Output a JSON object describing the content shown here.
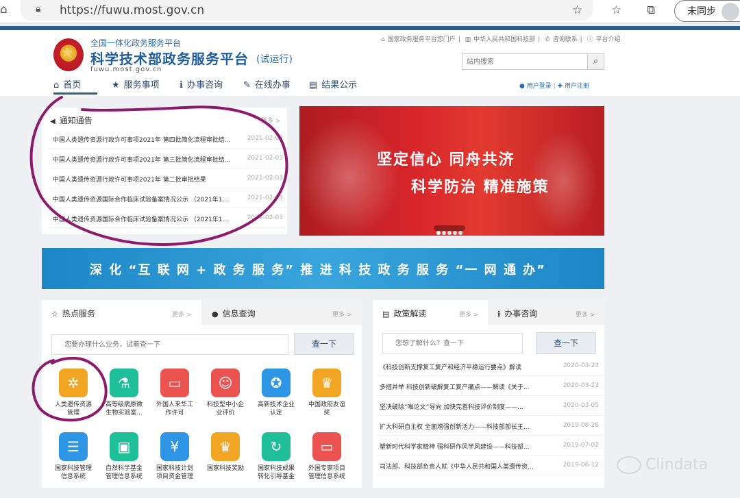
{
  "browser": {
    "url": "https://fuwu.most.gov.cn",
    "sync_label": "未同步"
  },
  "header": {
    "portal_sub": "全国一体化政务服务平台",
    "portal_title": "科学技术部政务服务平台",
    "portal_trial": "(试运行)",
    "portal_domain": "fuwu.most.gov.cn",
    "top_links": [
      "国家政务服务平台您门户",
      "中华人民共和国科技部",
      "咨询联系",
      "平台介绍"
    ],
    "search_placeholder": "站内搜索",
    "login": "用户登录",
    "register": "用户注册"
  },
  "nav": {
    "items": [
      "首页",
      "服务事项",
      "办事咨询",
      "在线办事",
      "结果公示"
    ]
  },
  "notice": {
    "title": "通知通告",
    "more": "更多 >",
    "rows": [
      {
        "title": "中国人类遗传资源行政许可事项2021年 第四批简化流程审批结...",
        "date": "2021-02-03"
      },
      {
        "title": "中国人类遗传资源行政许可事项2021年 第三批简化流程审批结...",
        "date": "2021-02-03"
      },
      {
        "title": "中国人类遗传资源行政许可事项2021年 第二批审批结果",
        "date": "2021-02-03"
      },
      {
        "title": "中国人类遗传资源国际合作临床试验备案情况公示 （2021年1...",
        "date": "2021-02-03"
      },
      {
        "title": "中国人类遗传资源国际合作临床试验备案情况公示 （2021年1...",
        "date": "2021-02-03"
      }
    ]
  },
  "banner": {
    "line1": "坚定信心  同舟共济",
    "line2": "科学防治  精准施策"
  },
  "slogan": {
    "text": "深 化  “互 联 网 + 政 务 服 务”   推 进 科 技 政 务 服 务 “一 网 通 办”"
  },
  "hot": {
    "tab1": "热点服务",
    "tab1_more": "更多 >",
    "tab2": "信息查询",
    "tab2_more": "更多 >",
    "search_placeholder": "您要办理什么业务，试着查一下",
    "search_button": "查一下",
    "services": [
      {
        "label": "人类遗传资源\n管理",
        "color": "#f2a522",
        "icon": "dna-icon"
      },
      {
        "label": "高等级病原微\n生物实验室...",
        "color": "#1fbf9a",
        "icon": "flask-icon"
      },
      {
        "label": "外国人来华工\n作许可",
        "color": "#ea5350",
        "icon": "monitor-icon"
      },
      {
        "label": "科技型中小企\n业评价",
        "color": "#ea5350",
        "icon": "person-icon"
      },
      {
        "label": "高新技术企业\n认定",
        "color": "#2f95e5",
        "icon": "medal-icon"
      },
      {
        "label": "中国政府友谊\n奖",
        "color": "#f2a522",
        "icon": "trophy-icon"
      },
      {
        "label": "国家科技管理\n信息系统",
        "color": "#2f95e5",
        "icon": "server-icon"
      },
      {
        "label": "自然科学基金\n管理信息系统",
        "color": "#1fbf9a",
        "icon": "wallet-icon"
      },
      {
        "label": "国家科技计划\n项目资金管理",
        "color": "#2f95e5",
        "icon": "fund-icon"
      },
      {
        "label": "国家科技奖励",
        "color": "#f2a522",
        "icon": "trophy-icon"
      },
      {
        "label": "国家科技成果\n转化引导基金",
        "color": "#1fbf9a",
        "icon": "cycle-icon"
      },
      {
        "label": "外国专家项目\n管理信息系统",
        "color": "#ea5350",
        "icon": "monitor-icon"
      }
    ]
  },
  "policy": {
    "tab1": "政策解读",
    "tab1_more": "更多 >",
    "tab2": "办事咨询",
    "tab2_more": "更多 >",
    "search_placeholder": "您想了解什么？查一下",
    "search_button": "查一下",
    "rows": [
      {
        "title": "《科技创新支撑复工复产和经济平稳运行要点》解读",
        "date": "2020-03-23"
      },
      {
        "title": "多措并举 科技创新破解复工复产痛点——解读《关于...",
        "date": "2020-03-23"
      },
      {
        "title": "坚决破除“唯论文”导向 加快完善科技评价制度——...",
        "date": "2020-03-05"
      },
      {
        "title": "扩大科研自主权 全面增强创新活力——科技部部长王...",
        "date": "2019-08-26"
      },
      {
        "title": "塑新时代科学家精神 强科研作风学风建设——科技部...",
        "date": "2019-07-02"
      },
      {
        "title": "司法部、科技部负责人就《中华人民共和国人类遗传资...",
        "date": "2019-06-12"
      }
    ]
  },
  "watermark": {
    "text": "Clindata"
  },
  "colors": {
    "brand": "#1f5d9e",
    "annotation": "#8e1a6e"
  }
}
